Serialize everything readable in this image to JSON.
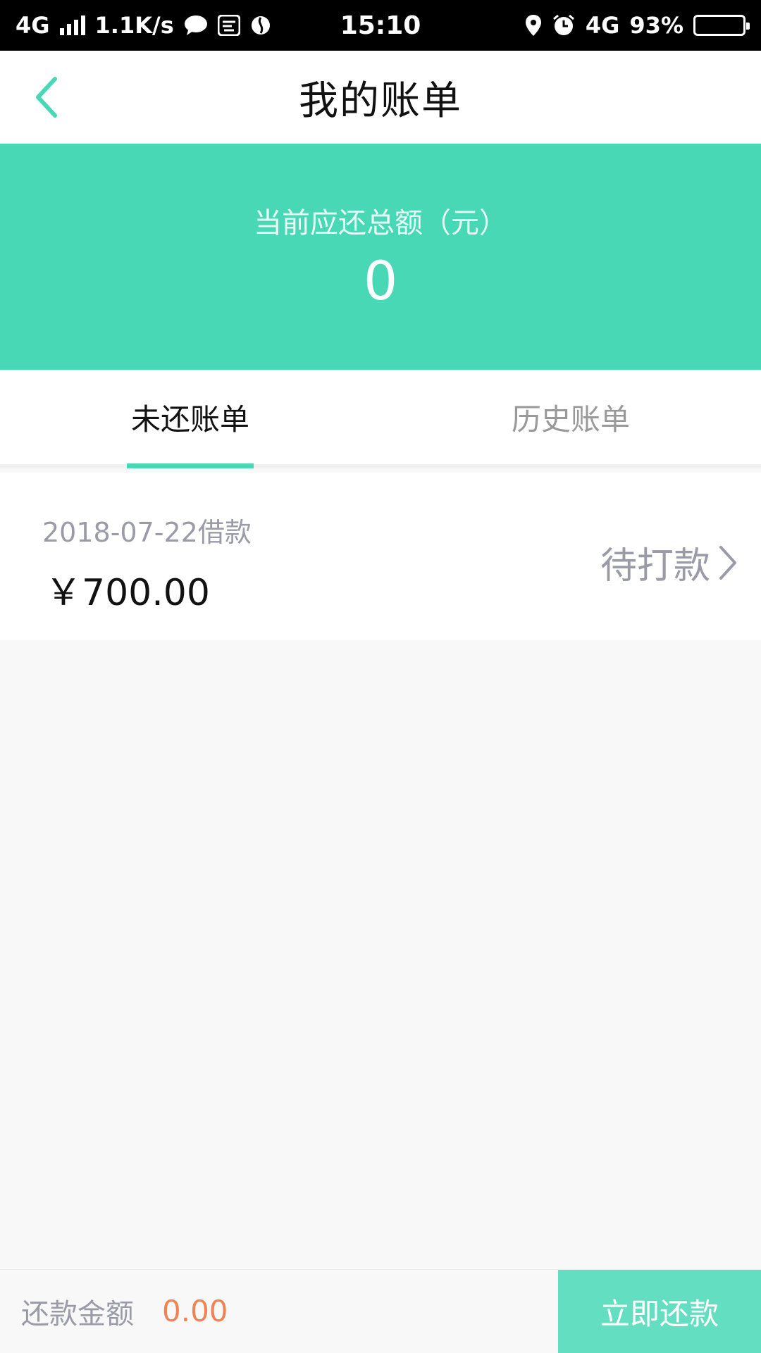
{
  "status_bar": {
    "network_left": "4G",
    "speed": "1.1K/s",
    "time": "15:10",
    "network_right": "4G",
    "battery": "93%",
    "battery_level": 0.93
  },
  "nav": {
    "title": "我的账单"
  },
  "summary": {
    "label": "当前应还总额（元）",
    "amount": "0"
  },
  "tabs": [
    {
      "label": "未还账单",
      "active": true
    },
    {
      "label": "历史账单",
      "active": false
    }
  ],
  "bills": [
    {
      "date": "2018-07-22借款",
      "amount": "￥700.00",
      "status": "待打款"
    }
  ],
  "bottom": {
    "pay_label": "还款金额",
    "pay_value": "0.00",
    "pay_button": "立即还款"
  },
  "colors": {
    "accent": "#48d8b5",
    "button": "#63dec1",
    "amount_highlight": "#ef8354"
  }
}
